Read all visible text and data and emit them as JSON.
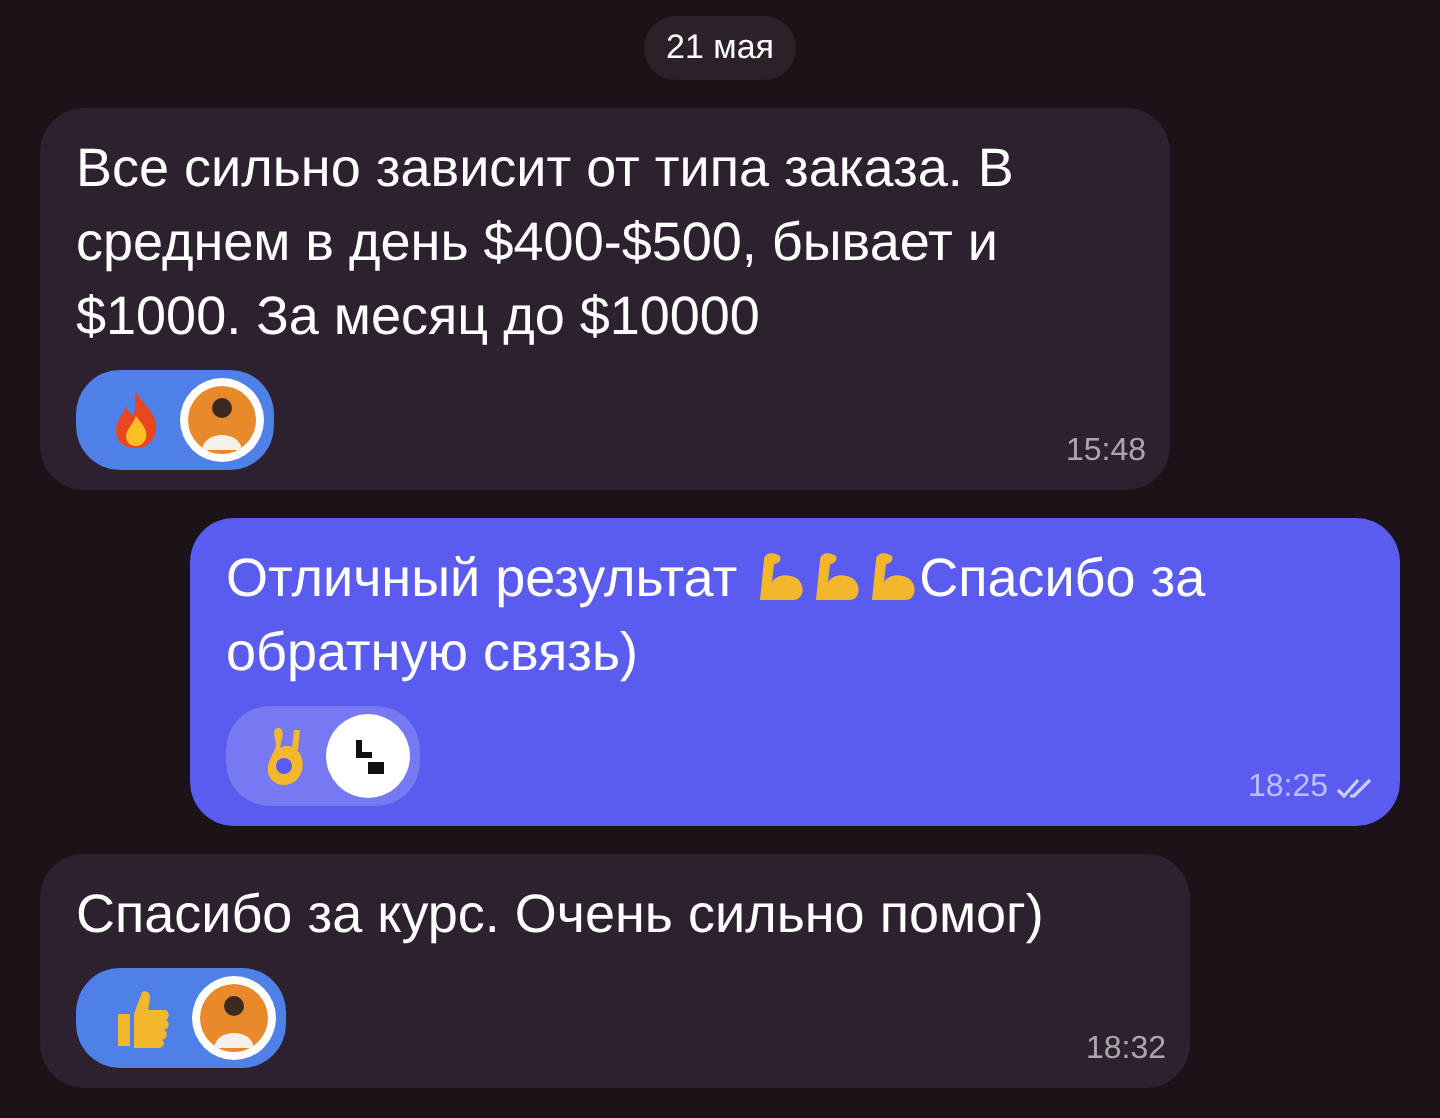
{
  "date": "21 мая",
  "messages": [
    {
      "outgoing": false,
      "parts": [
        {
          "kind": "text",
          "text": "Все сильно зависит от типа заказа. В среднем в день $400-$500, бывает и $1000. За месяц до $10000"
        }
      ],
      "reactions": [
        {
          "kind": "fire",
          "selected": true
        }
      ],
      "time": "15:48"
    },
    {
      "outgoing": true,
      "read": true,
      "parts": [
        {
          "kind": "text",
          "text": "Отличный результат"
        },
        {
          "kind": "muscle"
        },
        {
          "kind": "muscle"
        },
        {
          "kind": "muscle"
        },
        {
          "kind": "text",
          "text": "Спасибо за"
        },
        {
          "kind": "text",
          "text": "обратную связь)"
        }
      ],
      "reactions": [
        {
          "kind": "ok",
          "selected": false
        }
      ],
      "time": "18:25"
    },
    {
      "outgoing": false,
      "parts": [
        {
          "kind": "text",
          "text": "Спасибо за курс. Очень сильно помог)"
        }
      ],
      "reactions": [
        {
          "kind": "thumbs",
          "selected": true
        }
      ],
      "time": "18:32"
    }
  ]
}
